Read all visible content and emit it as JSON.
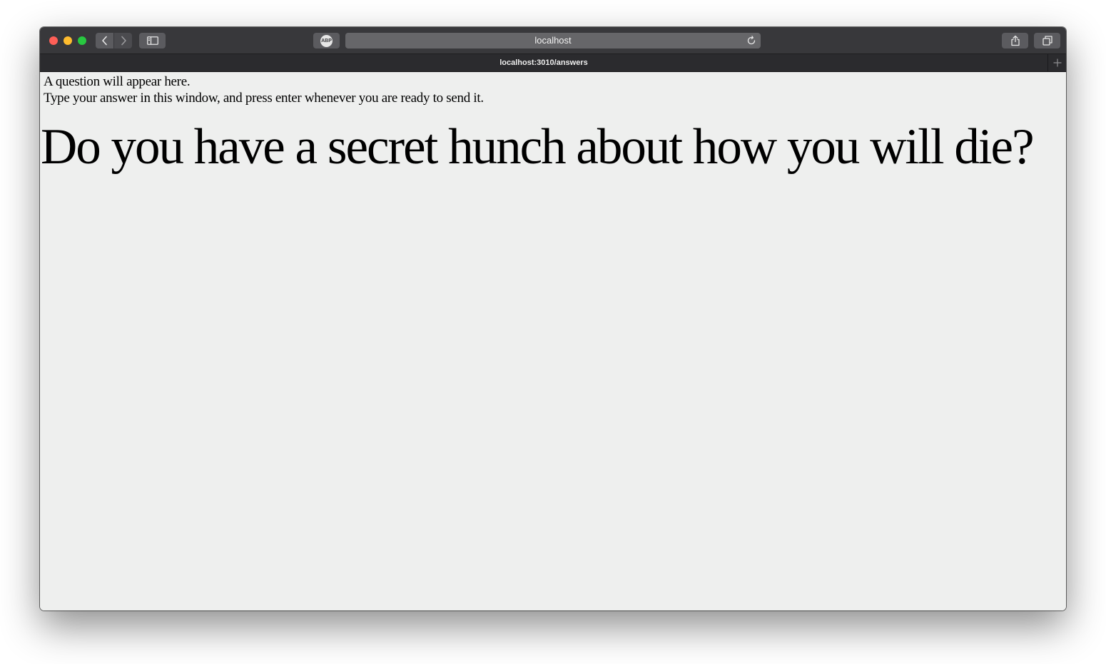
{
  "browser": {
    "address_bar_text": "localhost",
    "tab_title": "localhost:3010/answers",
    "extension_icon_label": "ABP",
    "icons": {
      "back": "chevron-left-icon",
      "forward": "chevron-right-icon",
      "sidebar": "sidebar-icon",
      "reload": "reload-icon",
      "share": "share-icon",
      "tabs": "tabs-overview-icon",
      "new_tab": "plus-icon"
    },
    "traffic_light_colors": {
      "close": "#fe5f57",
      "minimize": "#febc2e",
      "maximize": "#28c840"
    }
  },
  "page": {
    "intro_line_1": "A question will appear here.",
    "intro_line_2": "Type your answer in this window, and press enter whenever you are ready to send it.",
    "question": "Do you have a secret hunch about how you will die?",
    "background_color": "#eeefee"
  }
}
